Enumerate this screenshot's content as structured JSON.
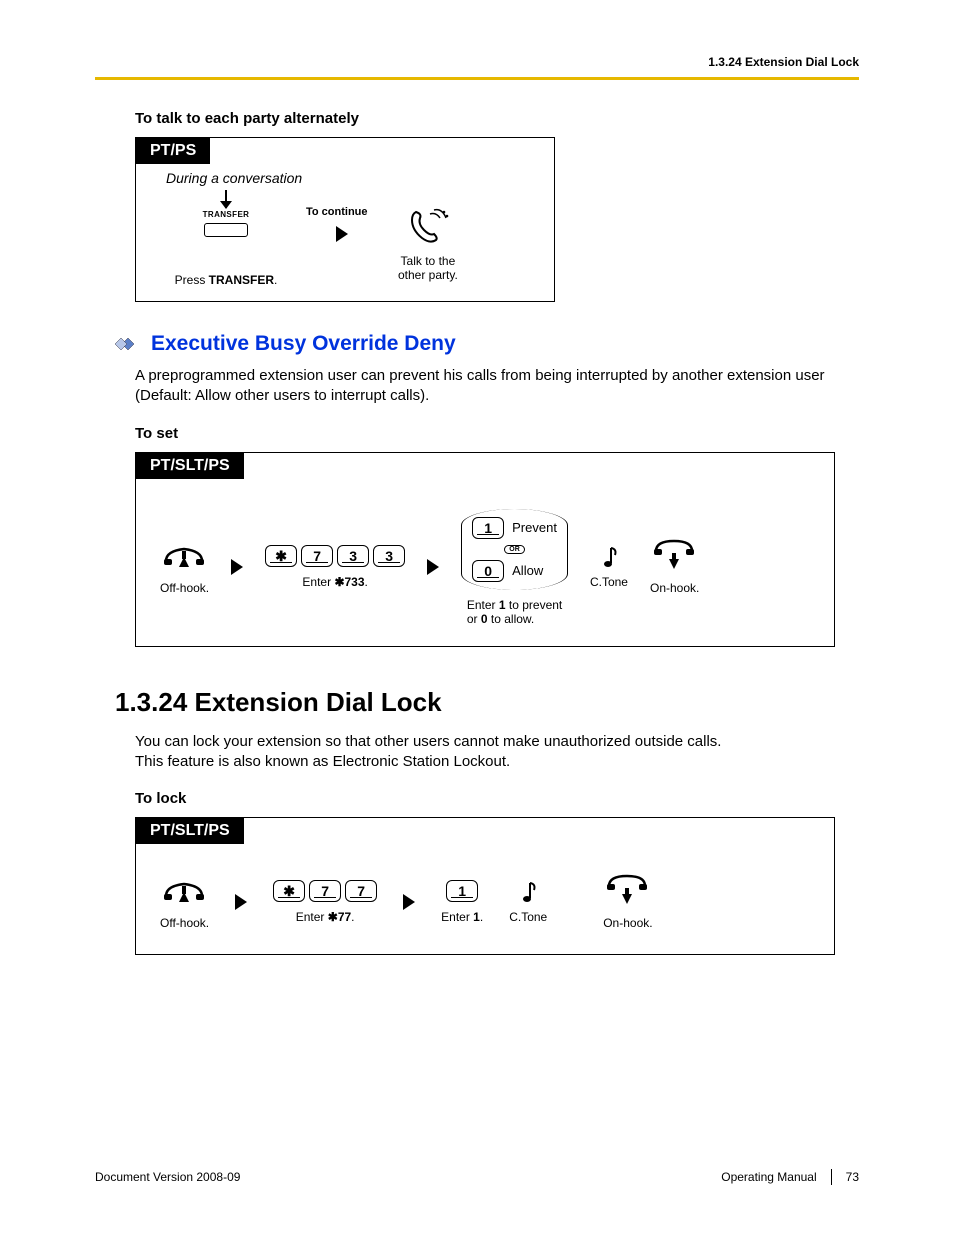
{
  "header": {
    "right": "1.3.24 Extension Dial Lock"
  },
  "s1": {
    "heading": "To talk to each party alternately",
    "tab": "PT/PS",
    "during": "During a conversation",
    "transfer_lbl": "TRANSFER",
    "press_txt": "Press ",
    "press_bold": "TRANSFER",
    "press_end": ".",
    "to_continue": "To continue",
    "talk1": "Talk to the",
    "talk2": "other party."
  },
  "exec": {
    "title": "Executive Busy Override Deny",
    "para": "A preprogrammed extension user can prevent his calls from being interrupted by another extension user (Default: Allow other users to interrupt calls).",
    "toset": "To set",
    "tab": "PT/SLT/PS",
    "offhook": "Off-hook.",
    "keys": [
      "7",
      "3",
      "3"
    ],
    "star": "✱",
    "enter_pre": "Enter ",
    "enter_code": "✱733",
    "enter_end": ".",
    "opt1": "1",
    "opt1lbl": "Prevent",
    "or": "OR",
    "opt0": "0",
    "opt0lbl": "Allow",
    "opt_cap1": "Enter ",
    "opt_cap1b": "1",
    "opt_cap1m": " to prevent",
    "opt_cap2": "or ",
    "opt_cap2b": "0",
    "opt_cap2m": " to allow.",
    "ctone": "C.Tone",
    "onhook": "On-hook."
  },
  "lock": {
    "title": "1.3.24  Extension Dial Lock",
    "para1": "You can lock your extension so that other users cannot make unauthorized outside calls.",
    "para2": "This feature is also known as Electronic Station Lockout.",
    "tolock": "To lock",
    "tab": "PT/SLT/PS",
    "offhook": "Off-hook.",
    "star": "✱",
    "keys": [
      "7",
      "7"
    ],
    "enter_pre": "Enter ",
    "enter_code": "✱77",
    "enter_end": ".",
    "key1": "1",
    "enter1_pre": "Enter ",
    "enter1_b": "1",
    "enter1_end": ".",
    "ctone": "C.Tone",
    "onhook": "On-hook."
  },
  "footer": {
    "left": "Document Version  2008-09",
    "mid": "Operating Manual",
    "page": "73"
  }
}
